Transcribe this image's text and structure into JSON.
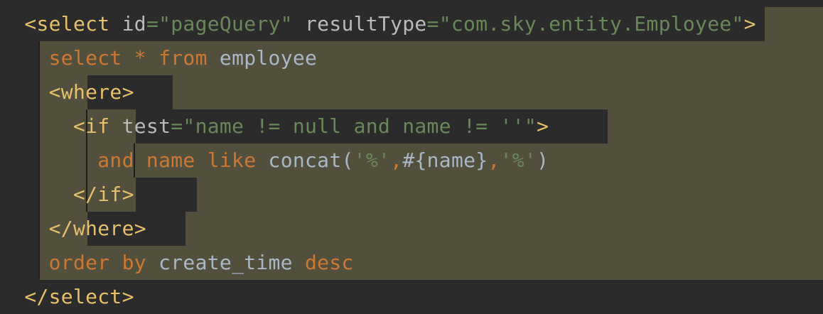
{
  "editor": {
    "lines": [
      {
        "indent": "  ",
        "tokens": [
          {
            "type": "tag",
            "text": "<select"
          },
          {
            "type": "plain",
            "text": " "
          },
          {
            "type": "attr",
            "text": "id"
          },
          {
            "type": "str",
            "text": "=\"pageQuery\""
          },
          {
            "type": "plain",
            "text": " "
          },
          {
            "type": "attr",
            "text": "resultType"
          },
          {
            "type": "str",
            "text": "=\"com.sky.entity.Employee\""
          },
          {
            "type": "tag",
            "text": ">"
          }
        ]
      },
      {
        "indent": "    ",
        "tokens": [
          {
            "type": "kw",
            "text": "select"
          },
          {
            "type": "plain",
            "text": " "
          },
          {
            "type": "kw",
            "text": "*"
          },
          {
            "type": "plain",
            "text": " "
          },
          {
            "type": "kw",
            "text": "from"
          },
          {
            "type": "plain",
            "text": " "
          },
          {
            "type": "id",
            "text": "employee"
          }
        ]
      },
      {
        "indent": "    ",
        "tokens": [
          {
            "type": "tag",
            "text": "<where>"
          }
        ]
      },
      {
        "indent": "      ",
        "tokens": [
          {
            "type": "tag",
            "text": "<if"
          },
          {
            "type": "plain",
            "text": " "
          },
          {
            "type": "attr",
            "text": "test"
          },
          {
            "type": "str",
            "text": "=\"name != null and name != ''\""
          },
          {
            "type": "tag",
            "text": ">"
          }
        ]
      },
      {
        "indent": "        ",
        "tokens": [
          {
            "type": "kw",
            "text": "and"
          },
          {
            "type": "plain",
            "text": " "
          },
          {
            "type": "kw",
            "text": "name"
          },
          {
            "type": "plain",
            "text": " "
          },
          {
            "type": "kw",
            "text": "like"
          },
          {
            "type": "plain",
            "text": " "
          },
          {
            "type": "id",
            "text": "concat("
          },
          {
            "type": "str",
            "text": "'%'"
          },
          {
            "type": "kw",
            "text": ","
          },
          {
            "type": "id",
            "text": "#{name}"
          },
          {
            "type": "kw",
            "text": ","
          },
          {
            "type": "str",
            "text": "'%'"
          },
          {
            "type": "id",
            "text": ")"
          }
        ]
      },
      {
        "indent": "      ",
        "tokens": [
          {
            "type": "tag",
            "text": "</if>"
          }
        ]
      },
      {
        "indent": "    ",
        "tokens": [
          {
            "type": "tag",
            "text": "</where>"
          }
        ]
      },
      {
        "indent": "    ",
        "tokens": [
          {
            "type": "kw",
            "text": "order"
          },
          {
            "type": "plain",
            "text": " "
          },
          {
            "type": "kw",
            "text": "by"
          },
          {
            "type": "plain",
            "text": " "
          },
          {
            "type": "id",
            "text": "create_time"
          },
          {
            "type": "plain",
            "text": " "
          },
          {
            "type": "kw",
            "text": "desc"
          }
        ]
      },
      {
        "indent": "  ",
        "tokens": [
          {
            "type": "tag",
            "text": "</select>"
          }
        ]
      }
    ]
  },
  "colors": {
    "background": "#2b2b2b",
    "highlight": "#52503c",
    "tag": "#e8bf6a",
    "attribute": "#bababa",
    "string": "#6a8759",
    "keyword": "#cc7832",
    "identifier": "#a9b7c6"
  }
}
